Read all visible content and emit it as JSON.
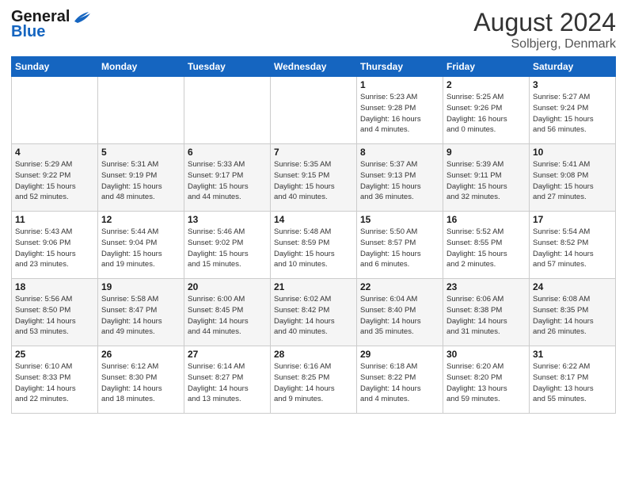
{
  "header": {
    "logo_general": "General",
    "logo_blue": "Blue",
    "month_title": "August 2024",
    "location": "Solbjerg, Denmark"
  },
  "weekdays": [
    "Sunday",
    "Monday",
    "Tuesday",
    "Wednesday",
    "Thursday",
    "Friday",
    "Saturday"
  ],
  "weeks": [
    [
      {
        "day": "",
        "info": ""
      },
      {
        "day": "",
        "info": ""
      },
      {
        "day": "",
        "info": ""
      },
      {
        "day": "",
        "info": ""
      },
      {
        "day": "1",
        "info": "Sunrise: 5:23 AM\nSunset: 9:28 PM\nDaylight: 16 hours\nand 4 minutes."
      },
      {
        "day": "2",
        "info": "Sunrise: 5:25 AM\nSunset: 9:26 PM\nDaylight: 16 hours\nand 0 minutes."
      },
      {
        "day": "3",
        "info": "Sunrise: 5:27 AM\nSunset: 9:24 PM\nDaylight: 15 hours\nand 56 minutes."
      }
    ],
    [
      {
        "day": "4",
        "info": "Sunrise: 5:29 AM\nSunset: 9:22 PM\nDaylight: 15 hours\nand 52 minutes."
      },
      {
        "day": "5",
        "info": "Sunrise: 5:31 AM\nSunset: 9:19 PM\nDaylight: 15 hours\nand 48 minutes."
      },
      {
        "day": "6",
        "info": "Sunrise: 5:33 AM\nSunset: 9:17 PM\nDaylight: 15 hours\nand 44 minutes."
      },
      {
        "day": "7",
        "info": "Sunrise: 5:35 AM\nSunset: 9:15 PM\nDaylight: 15 hours\nand 40 minutes."
      },
      {
        "day": "8",
        "info": "Sunrise: 5:37 AM\nSunset: 9:13 PM\nDaylight: 15 hours\nand 36 minutes."
      },
      {
        "day": "9",
        "info": "Sunrise: 5:39 AM\nSunset: 9:11 PM\nDaylight: 15 hours\nand 32 minutes."
      },
      {
        "day": "10",
        "info": "Sunrise: 5:41 AM\nSunset: 9:08 PM\nDaylight: 15 hours\nand 27 minutes."
      }
    ],
    [
      {
        "day": "11",
        "info": "Sunrise: 5:43 AM\nSunset: 9:06 PM\nDaylight: 15 hours\nand 23 minutes."
      },
      {
        "day": "12",
        "info": "Sunrise: 5:44 AM\nSunset: 9:04 PM\nDaylight: 15 hours\nand 19 minutes."
      },
      {
        "day": "13",
        "info": "Sunrise: 5:46 AM\nSunset: 9:02 PM\nDaylight: 15 hours\nand 15 minutes."
      },
      {
        "day": "14",
        "info": "Sunrise: 5:48 AM\nSunset: 8:59 PM\nDaylight: 15 hours\nand 10 minutes."
      },
      {
        "day": "15",
        "info": "Sunrise: 5:50 AM\nSunset: 8:57 PM\nDaylight: 15 hours\nand 6 minutes."
      },
      {
        "day": "16",
        "info": "Sunrise: 5:52 AM\nSunset: 8:55 PM\nDaylight: 15 hours\nand 2 minutes."
      },
      {
        "day": "17",
        "info": "Sunrise: 5:54 AM\nSunset: 8:52 PM\nDaylight: 14 hours\nand 57 minutes."
      }
    ],
    [
      {
        "day": "18",
        "info": "Sunrise: 5:56 AM\nSunset: 8:50 PM\nDaylight: 14 hours\nand 53 minutes."
      },
      {
        "day": "19",
        "info": "Sunrise: 5:58 AM\nSunset: 8:47 PM\nDaylight: 14 hours\nand 49 minutes."
      },
      {
        "day": "20",
        "info": "Sunrise: 6:00 AM\nSunset: 8:45 PM\nDaylight: 14 hours\nand 44 minutes."
      },
      {
        "day": "21",
        "info": "Sunrise: 6:02 AM\nSunset: 8:42 PM\nDaylight: 14 hours\nand 40 minutes."
      },
      {
        "day": "22",
        "info": "Sunrise: 6:04 AM\nSunset: 8:40 PM\nDaylight: 14 hours\nand 35 minutes."
      },
      {
        "day": "23",
        "info": "Sunrise: 6:06 AM\nSunset: 8:38 PM\nDaylight: 14 hours\nand 31 minutes."
      },
      {
        "day": "24",
        "info": "Sunrise: 6:08 AM\nSunset: 8:35 PM\nDaylight: 14 hours\nand 26 minutes."
      }
    ],
    [
      {
        "day": "25",
        "info": "Sunrise: 6:10 AM\nSunset: 8:33 PM\nDaylight: 14 hours\nand 22 minutes."
      },
      {
        "day": "26",
        "info": "Sunrise: 6:12 AM\nSunset: 8:30 PM\nDaylight: 14 hours\nand 18 minutes."
      },
      {
        "day": "27",
        "info": "Sunrise: 6:14 AM\nSunset: 8:27 PM\nDaylight: 14 hours\nand 13 minutes."
      },
      {
        "day": "28",
        "info": "Sunrise: 6:16 AM\nSunset: 8:25 PM\nDaylight: 14 hours\nand 9 minutes."
      },
      {
        "day": "29",
        "info": "Sunrise: 6:18 AM\nSunset: 8:22 PM\nDaylight: 14 hours\nand 4 minutes."
      },
      {
        "day": "30",
        "info": "Sunrise: 6:20 AM\nSunset: 8:20 PM\nDaylight: 13 hours\nand 59 minutes."
      },
      {
        "day": "31",
        "info": "Sunrise: 6:22 AM\nSunset: 8:17 PM\nDaylight: 13 hours\nand 55 minutes."
      }
    ]
  ]
}
